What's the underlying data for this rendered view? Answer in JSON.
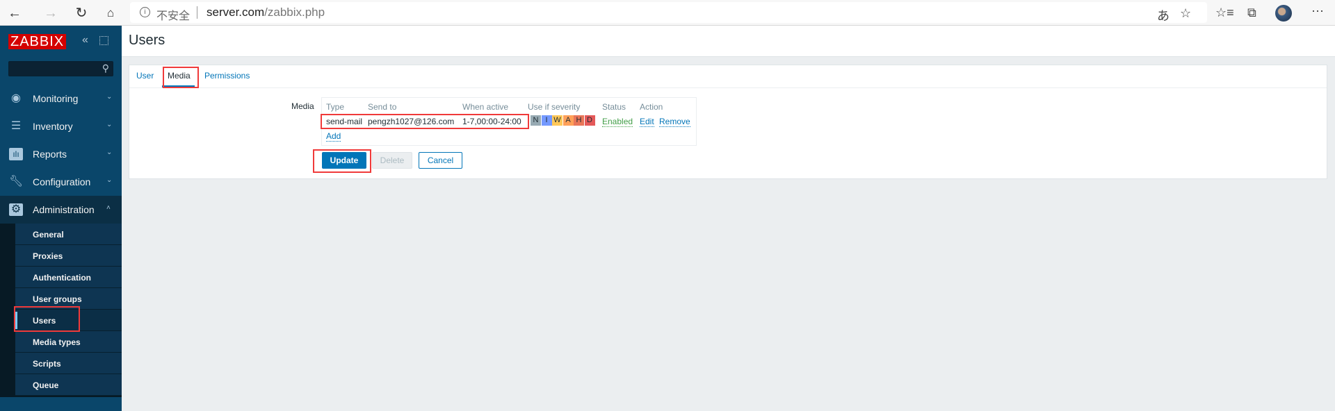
{
  "browser": {
    "security_label": "不安全",
    "url_host": "server.com",
    "url_path": "/zabbix.php"
  },
  "sidebar": {
    "logo": "ZABBIX",
    "menu": [
      {
        "label": "Monitoring",
        "icon": "eye-icon"
      },
      {
        "label": "Inventory",
        "icon": "list-icon"
      },
      {
        "label": "Reports",
        "icon": "bar-chart-icon"
      },
      {
        "label": "Configuration",
        "icon": "wrench-icon"
      },
      {
        "label": "Administration",
        "icon": "gear-icon"
      }
    ],
    "submenu": [
      "General",
      "Proxies",
      "Authentication",
      "User groups",
      "Users",
      "Media types",
      "Scripts",
      "Queue"
    ],
    "selected_submenu": "Users"
  },
  "page": {
    "title": "Users"
  },
  "tabs": [
    "User",
    "Media",
    "Permissions"
  ],
  "active_tab": "Media",
  "media": {
    "label": "Media",
    "headers": [
      "Type",
      "Send to",
      "When active",
      "Use if severity",
      "Status",
      "Action"
    ],
    "rows": [
      {
        "type": "send-mail",
        "send_to": "pengzh1027@126.com",
        "when_active": "1-7,00:00-24:00",
        "severity": [
          {
            "label": "N",
            "color": "#97aab3"
          },
          {
            "label": "I",
            "color": "#7499ff"
          },
          {
            "label": "W",
            "color": "#ffc859"
          },
          {
            "label": "A",
            "color": "#ffa059"
          },
          {
            "label": "H",
            "color": "#e97659"
          },
          {
            "label": "D",
            "color": "#e45959"
          }
        ],
        "status": "Enabled",
        "edit": "Edit",
        "remove": "Remove"
      }
    ],
    "add": "Add"
  },
  "buttons": {
    "update": "Update",
    "delete": "Delete",
    "cancel": "Cancel"
  }
}
